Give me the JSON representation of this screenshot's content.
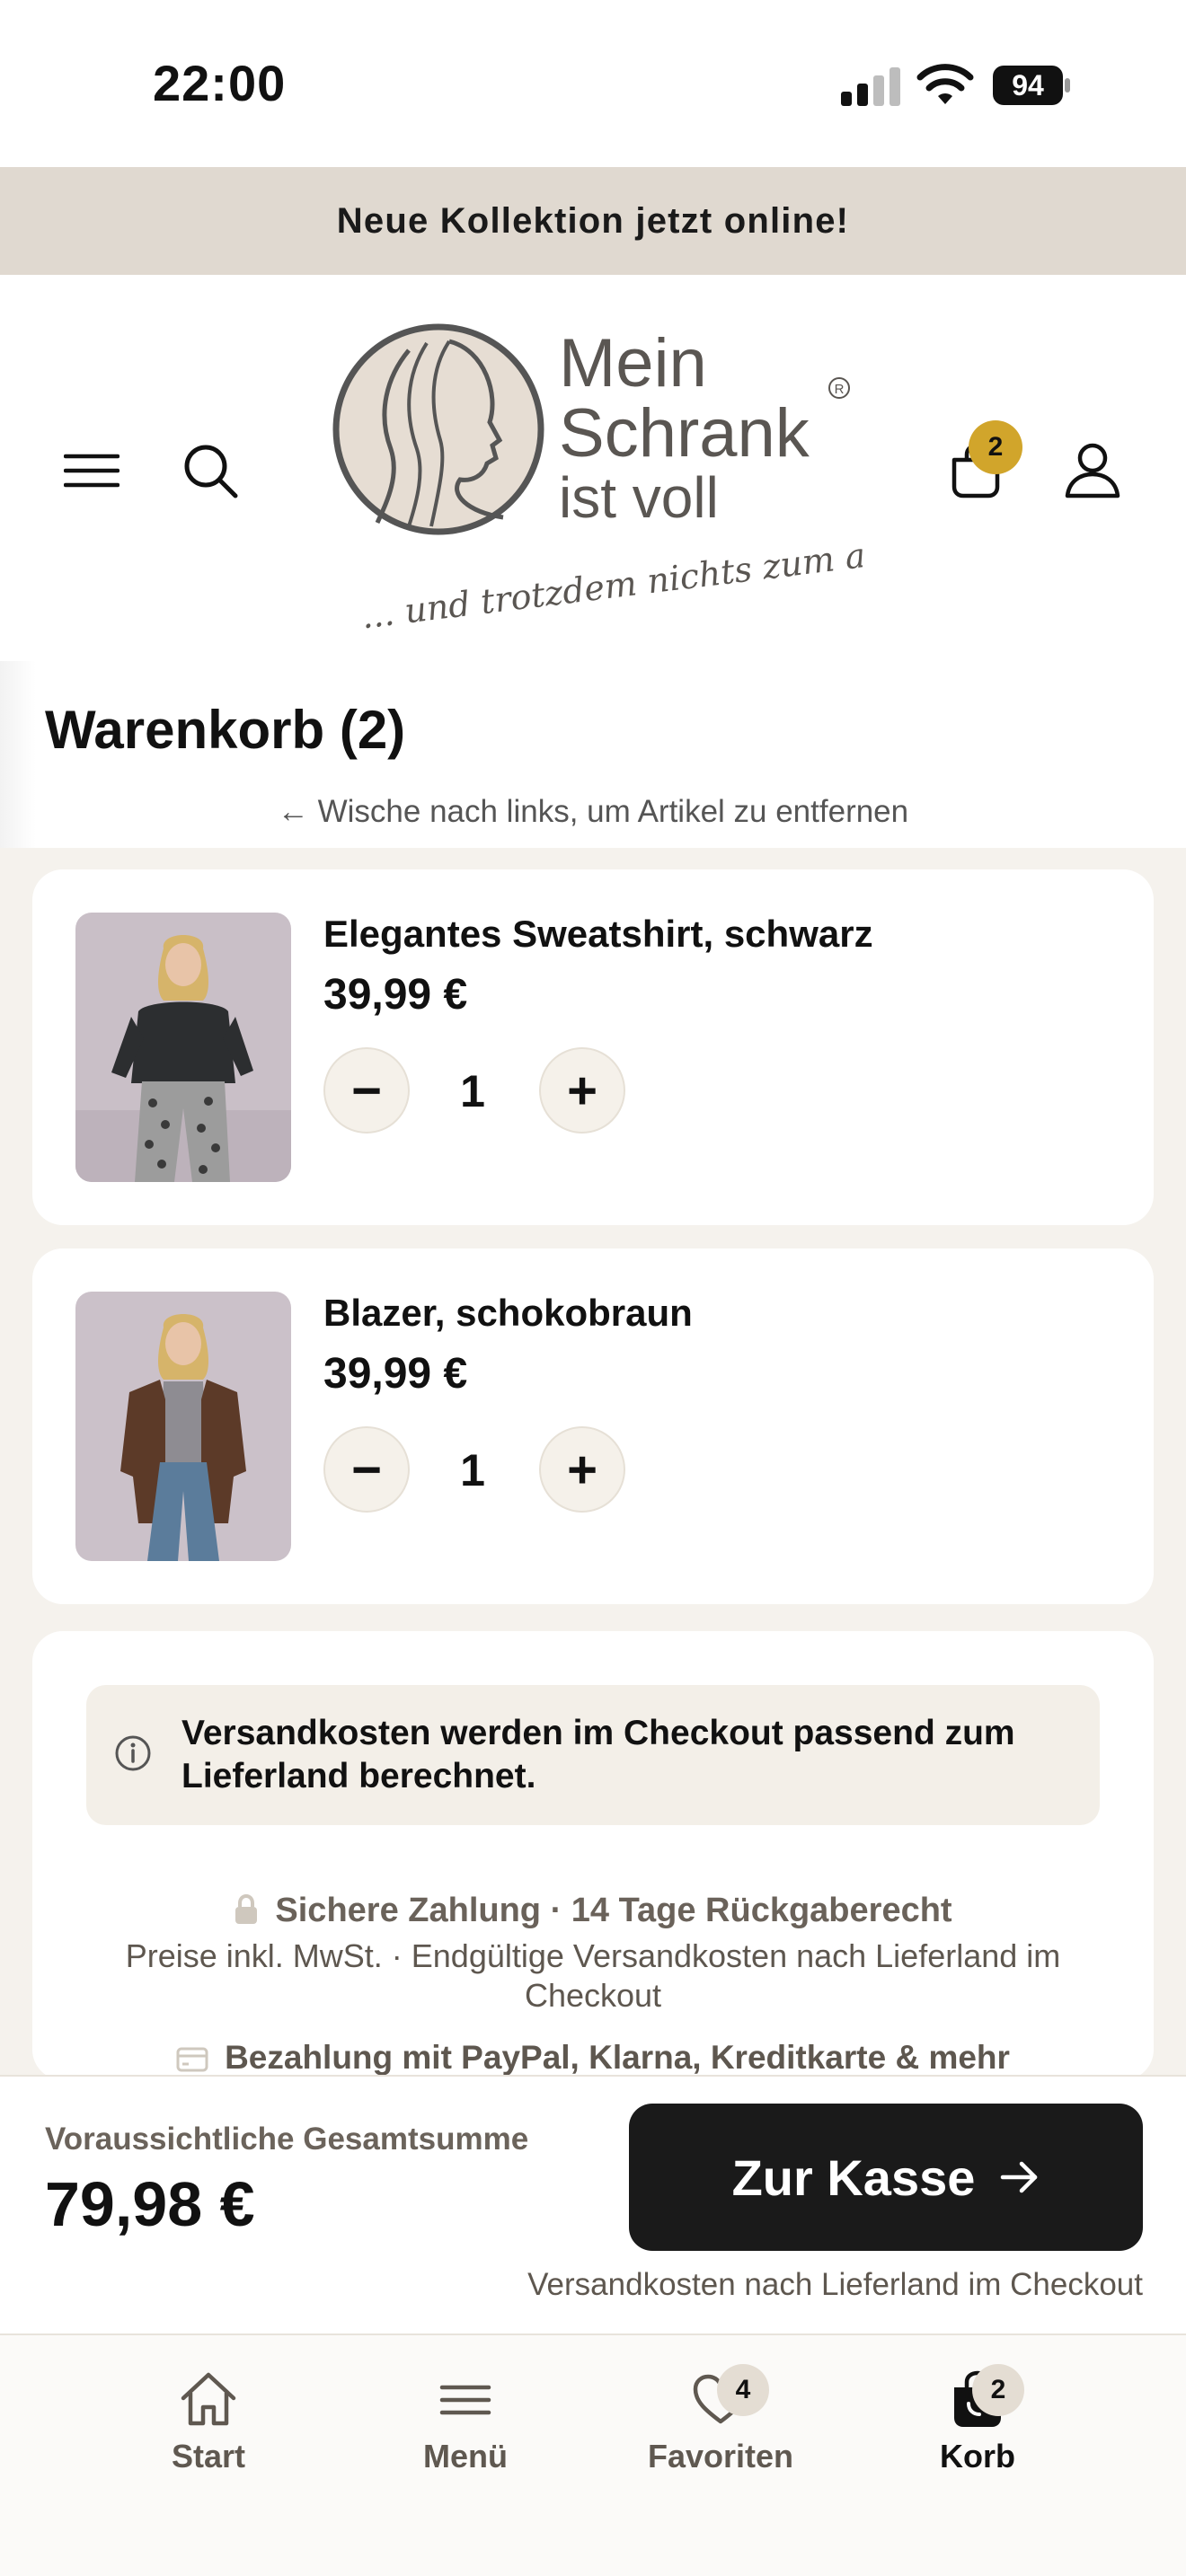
{
  "status_bar": {
    "time": "22:00",
    "battery": "94"
  },
  "announcement": "Neue Kollektion jetzt online!",
  "header": {
    "cart_count": "2",
    "logo": {
      "line1": "Mein",
      "line2": "Schrank",
      "line3": "ist voll",
      "tagline": "... und trotzdem nichts zum anziehen!"
    }
  },
  "cart": {
    "title": "Warenkorb (2)",
    "swipe_hint": "← Wische nach links, um Artikel zu entfernen",
    "items": [
      {
        "name": "Elegantes Sweatshirt, schwarz",
        "price": "39,99 €",
        "qty": "1",
        "minus": "−",
        "plus": "+"
      },
      {
        "name": "Blazer, schokobraun",
        "price": "39,99 €",
        "qty": "1",
        "minus": "−",
        "plus": "+"
      }
    ]
  },
  "info": {
    "notice": "Versandkosten werden im Checkout passend zum Lieferland berechnet.",
    "trust_line": "Sichere Zahlung · 14 Tage Rückgaberecht",
    "tax_line": "Preise inkl. MwSt. · Endgültige Versandkosten nach Lieferland im Checkout",
    "payment_line": "Bezahlung mit PayPal, Klarna, Kreditkarte & mehr"
  },
  "total": {
    "label": "Voraussichtliche Gesamtsumme",
    "value": "79,98 €",
    "checkout_label": "Zur Kasse",
    "shipping_note": "Versandkosten nach Lieferland im Checkout"
  },
  "tabs": [
    {
      "label": "Start",
      "icon": "home-icon"
    },
    {
      "label": "Menü",
      "icon": "menu-icon"
    },
    {
      "label": "Favoriten",
      "icon": "heart-icon",
      "badge": "4"
    },
    {
      "label": "Korb",
      "icon": "bag-icon",
      "badge": "2"
    }
  ],
  "colors": {
    "accent_badge": "#d1a52b",
    "announcement_bg": "#e0d9d0",
    "cart_bg": "#f5f2ed",
    "checkout_bg": "#1a1a1a"
  }
}
